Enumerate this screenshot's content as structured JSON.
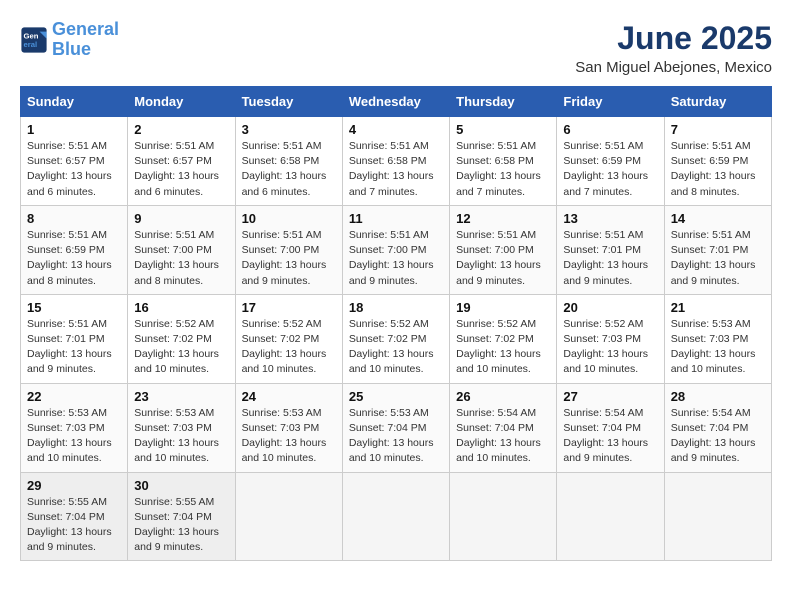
{
  "header": {
    "logo_line1": "General",
    "logo_line2": "Blue",
    "month_title": "June 2025",
    "subtitle": "San Miguel Abejones, Mexico"
  },
  "weekdays": [
    "Sunday",
    "Monday",
    "Tuesday",
    "Wednesday",
    "Thursday",
    "Friday",
    "Saturday"
  ],
  "weeks": [
    [
      {
        "day": "1",
        "info": "Sunrise: 5:51 AM\nSunset: 6:57 PM\nDaylight: 13 hours\nand 6 minutes."
      },
      {
        "day": "2",
        "info": "Sunrise: 5:51 AM\nSunset: 6:57 PM\nDaylight: 13 hours\nand 6 minutes."
      },
      {
        "day": "3",
        "info": "Sunrise: 5:51 AM\nSunset: 6:58 PM\nDaylight: 13 hours\nand 6 minutes."
      },
      {
        "day": "4",
        "info": "Sunrise: 5:51 AM\nSunset: 6:58 PM\nDaylight: 13 hours\nand 7 minutes."
      },
      {
        "day": "5",
        "info": "Sunrise: 5:51 AM\nSunset: 6:58 PM\nDaylight: 13 hours\nand 7 minutes."
      },
      {
        "day": "6",
        "info": "Sunrise: 5:51 AM\nSunset: 6:59 PM\nDaylight: 13 hours\nand 7 minutes."
      },
      {
        "day": "7",
        "info": "Sunrise: 5:51 AM\nSunset: 6:59 PM\nDaylight: 13 hours\nand 8 minutes."
      }
    ],
    [
      {
        "day": "8",
        "info": "Sunrise: 5:51 AM\nSunset: 6:59 PM\nDaylight: 13 hours\nand 8 minutes."
      },
      {
        "day": "9",
        "info": "Sunrise: 5:51 AM\nSunset: 7:00 PM\nDaylight: 13 hours\nand 8 minutes."
      },
      {
        "day": "10",
        "info": "Sunrise: 5:51 AM\nSunset: 7:00 PM\nDaylight: 13 hours\nand 9 minutes."
      },
      {
        "day": "11",
        "info": "Sunrise: 5:51 AM\nSunset: 7:00 PM\nDaylight: 13 hours\nand 9 minutes."
      },
      {
        "day": "12",
        "info": "Sunrise: 5:51 AM\nSunset: 7:00 PM\nDaylight: 13 hours\nand 9 minutes."
      },
      {
        "day": "13",
        "info": "Sunrise: 5:51 AM\nSunset: 7:01 PM\nDaylight: 13 hours\nand 9 minutes."
      },
      {
        "day": "14",
        "info": "Sunrise: 5:51 AM\nSunset: 7:01 PM\nDaylight: 13 hours\nand 9 minutes."
      }
    ],
    [
      {
        "day": "15",
        "info": "Sunrise: 5:51 AM\nSunset: 7:01 PM\nDaylight: 13 hours\nand 9 minutes."
      },
      {
        "day": "16",
        "info": "Sunrise: 5:52 AM\nSunset: 7:02 PM\nDaylight: 13 hours\nand 10 minutes."
      },
      {
        "day": "17",
        "info": "Sunrise: 5:52 AM\nSunset: 7:02 PM\nDaylight: 13 hours\nand 10 minutes."
      },
      {
        "day": "18",
        "info": "Sunrise: 5:52 AM\nSunset: 7:02 PM\nDaylight: 13 hours\nand 10 minutes."
      },
      {
        "day": "19",
        "info": "Sunrise: 5:52 AM\nSunset: 7:02 PM\nDaylight: 13 hours\nand 10 minutes."
      },
      {
        "day": "20",
        "info": "Sunrise: 5:52 AM\nSunset: 7:03 PM\nDaylight: 13 hours\nand 10 minutes."
      },
      {
        "day": "21",
        "info": "Sunrise: 5:53 AM\nSunset: 7:03 PM\nDaylight: 13 hours\nand 10 minutes."
      }
    ],
    [
      {
        "day": "22",
        "info": "Sunrise: 5:53 AM\nSunset: 7:03 PM\nDaylight: 13 hours\nand 10 minutes."
      },
      {
        "day": "23",
        "info": "Sunrise: 5:53 AM\nSunset: 7:03 PM\nDaylight: 13 hours\nand 10 minutes."
      },
      {
        "day": "24",
        "info": "Sunrise: 5:53 AM\nSunset: 7:03 PM\nDaylight: 13 hours\nand 10 minutes."
      },
      {
        "day": "25",
        "info": "Sunrise: 5:53 AM\nSunset: 7:04 PM\nDaylight: 13 hours\nand 10 minutes."
      },
      {
        "day": "26",
        "info": "Sunrise: 5:54 AM\nSunset: 7:04 PM\nDaylight: 13 hours\nand 10 minutes."
      },
      {
        "day": "27",
        "info": "Sunrise: 5:54 AM\nSunset: 7:04 PM\nDaylight: 13 hours\nand 9 minutes."
      },
      {
        "day": "28",
        "info": "Sunrise: 5:54 AM\nSunset: 7:04 PM\nDaylight: 13 hours\nand 9 minutes."
      }
    ],
    [
      {
        "day": "29",
        "info": "Sunrise: 5:55 AM\nSunset: 7:04 PM\nDaylight: 13 hours\nand 9 minutes."
      },
      {
        "day": "30",
        "info": "Sunrise: 5:55 AM\nSunset: 7:04 PM\nDaylight: 13 hours\nand 9 minutes."
      },
      {
        "day": "",
        "info": ""
      },
      {
        "day": "",
        "info": ""
      },
      {
        "day": "",
        "info": ""
      },
      {
        "day": "",
        "info": ""
      },
      {
        "day": "",
        "info": ""
      }
    ]
  ]
}
